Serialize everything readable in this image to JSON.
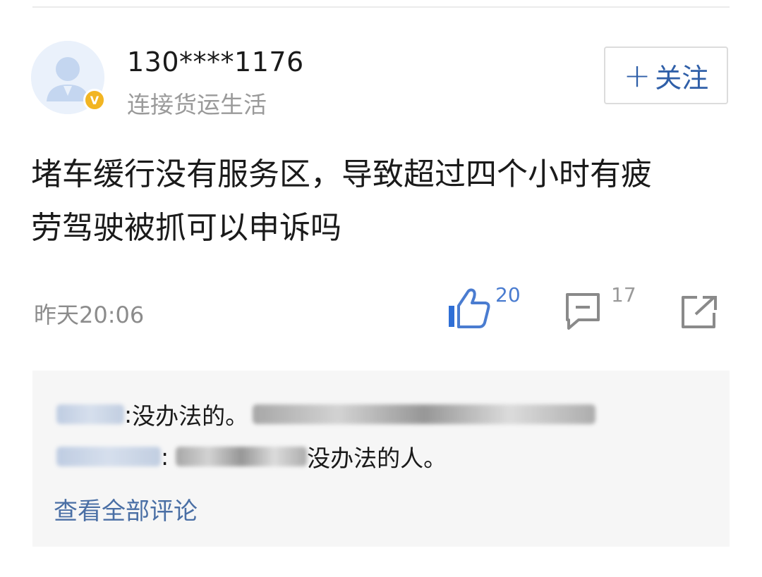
{
  "post": {
    "author": {
      "name": "130****1176",
      "tagline": "连接货运生活",
      "verified_badge": "V"
    },
    "follow_label": "关注",
    "text_lines": [
      "堵车缓行没有服务区，导致超过四个小时有疲",
      "劳驾驶被抓可以申诉吗"
    ],
    "time": "昨天20:06",
    "likes": "20",
    "comments": "17",
    "icons": {
      "like": "thumbs-up-icon",
      "comment": "comment-icon",
      "share": "share-icon",
      "avatar": "default-user-avatar"
    },
    "colors": {
      "accent": "#2f5fa8",
      "link": "#4a6fa5",
      "like": "#4a7cd0",
      "badge": "#f2b522",
      "panel_bg": "#f6f6f6"
    }
  },
  "comments_preview": {
    "items": [
      {
        "separator": ":",
        "text": "没办法的。"
      },
      {
        "separator": ":",
        "text": "没办法的人。"
      }
    ],
    "view_all_label": "查看全部评论"
  }
}
